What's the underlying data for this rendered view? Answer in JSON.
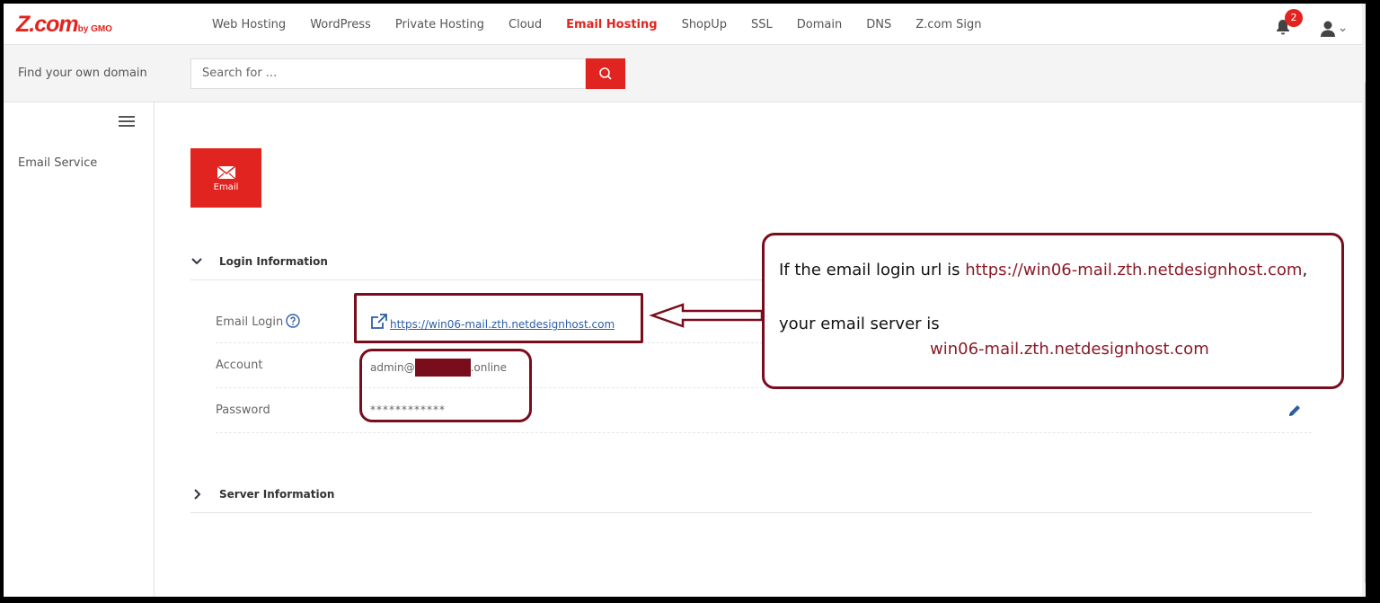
{
  "brand": {
    "logo_text": "Z.com",
    "logo_sub": "by GMO"
  },
  "nav": {
    "items": [
      {
        "label": "Web Hosting"
      },
      {
        "label": "WordPress"
      },
      {
        "label": "Private Hosting"
      },
      {
        "label": "Cloud"
      },
      {
        "label": "Email Hosting",
        "active": true
      },
      {
        "label": "ShopUp"
      },
      {
        "label": "SSL"
      },
      {
        "label": "Domain"
      },
      {
        "label": "DNS"
      },
      {
        "label": "Z.com Sign"
      }
    ],
    "notification_count": "2"
  },
  "search": {
    "find_label": "Find your own domain",
    "placeholder": "Search for ..."
  },
  "sidebar": {
    "items": [
      {
        "label": "Email Service"
      }
    ]
  },
  "main": {
    "tile_label": "Email",
    "login_section": {
      "title": "Login Information",
      "rows": [
        {
          "label": "Email Login",
          "value": "https://win06-mail.zth.netdesignhost.com"
        },
        {
          "label": "Account",
          "value_prefix": "admin@",
          "value_suffix": ".online"
        },
        {
          "label": "Password",
          "value": "************"
        }
      ]
    },
    "server_section": {
      "title": "Server Information"
    }
  },
  "annotation": {
    "line1_text": "If the email login url is ",
    "line1_url": "https://win06-mail.zth.netdesignhost.com",
    "line1_end": ",",
    "line2": "your email server is",
    "line3": "win06-mail.zth.netdesignhost.com"
  },
  "colors": {
    "brand_red": "#e1241f",
    "annotation_maroon": "#7a0d1c",
    "link_blue": "#2b5fa8"
  },
  "icons": [
    "bell-icon",
    "user-icon",
    "search-icon",
    "hamburger-icon",
    "envelope-icon",
    "chevron-down-icon",
    "chevron-right-icon",
    "help-icon",
    "external-link-icon",
    "pencil-icon"
  ]
}
